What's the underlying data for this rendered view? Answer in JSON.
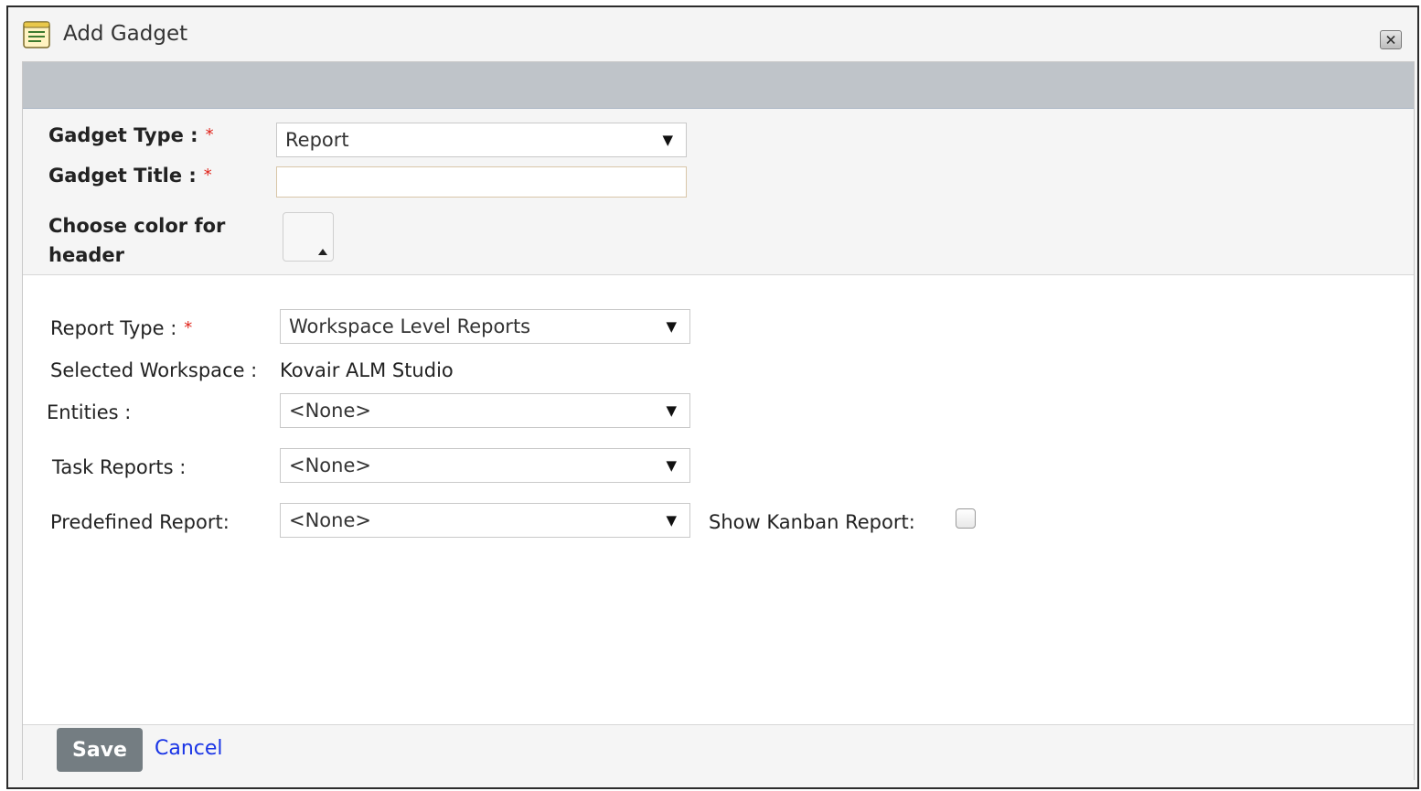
{
  "dialog": {
    "title": "Add Gadget"
  },
  "form": {
    "gadget_type_label": "Gadget Type :",
    "gadget_type_value": "Report",
    "gadget_title_label": "Gadget Title :",
    "gadget_title_value": "",
    "color_label_line1": "Choose color for",
    "color_label_line2": "header",
    "required_mark": "*",
    "report_type_label": "Report Type :",
    "report_type_value": "Workspace Level Reports",
    "selected_workspace_label": "Selected Workspace :",
    "selected_workspace_value": "Kovair ALM Studio",
    "entities_label": "Entities :",
    "entities_value": "<None>",
    "task_reports_label": "Task Reports :",
    "task_reports_value": "<None>",
    "predefined_report_label": "Predefined Report:",
    "predefined_report_value": "<None>",
    "show_kanban_label": "Show Kanban Report:",
    "dropdown_arrow": "▼"
  },
  "footer": {
    "save_label": "Save",
    "cancel_label": "Cancel"
  },
  "colors": {
    "header_strip": "#bfc4c9",
    "save_button": "#747d82",
    "cancel_link": "#1a35e6",
    "required": "#e0241b"
  },
  "icons": {
    "title": "gadget-list-icon",
    "close": "close-icon"
  }
}
